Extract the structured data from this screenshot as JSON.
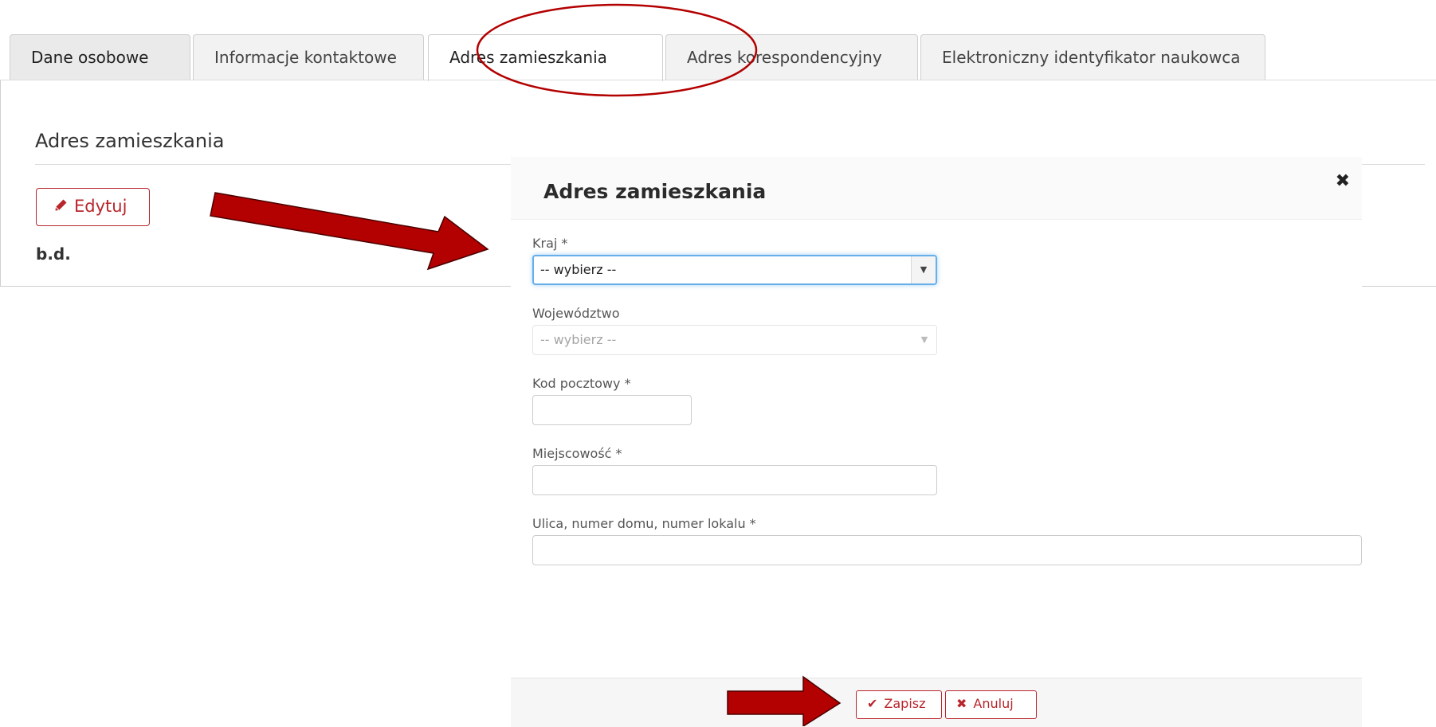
{
  "tabs": [
    {
      "label": "Dane osobowe"
    },
    {
      "label": "Informacje kontaktowe"
    },
    {
      "label": "Adres zamieszkania"
    },
    {
      "label": "Adres korespondencyjny"
    },
    {
      "label": "Elektroniczny identyfikator naukowca"
    }
  ],
  "active_tab": "Adres zamieszkania",
  "panel": {
    "title": "Adres zamieszkania",
    "edit_label": "Edytuj",
    "value": "b.d."
  },
  "modal": {
    "title": "Adres zamieszkania",
    "close_glyph": "✖",
    "fields": {
      "kraj": {
        "label": "Kraj *",
        "value": "-- wybierz --"
      },
      "wojewodztwo": {
        "label": "Województwo",
        "value": "-- wybierz --"
      },
      "kod": {
        "label": "Kod pocztowy *",
        "value": ""
      },
      "miejscowosc": {
        "label": "Miejscowość *",
        "value": ""
      },
      "ulica": {
        "label": "Ulica, numer domu, numer lokalu *",
        "value": ""
      }
    },
    "save_label": "Zapisz",
    "cancel_label": "Anuluj"
  },
  "icons": {
    "edit": "pencil-icon",
    "save": "check-icon",
    "cancel": "x-icon",
    "dropdown": "caret-down-icon"
  },
  "colors": {
    "accent": "#b8262c",
    "annotation": "#b30000",
    "focus": "#66afe9"
  }
}
